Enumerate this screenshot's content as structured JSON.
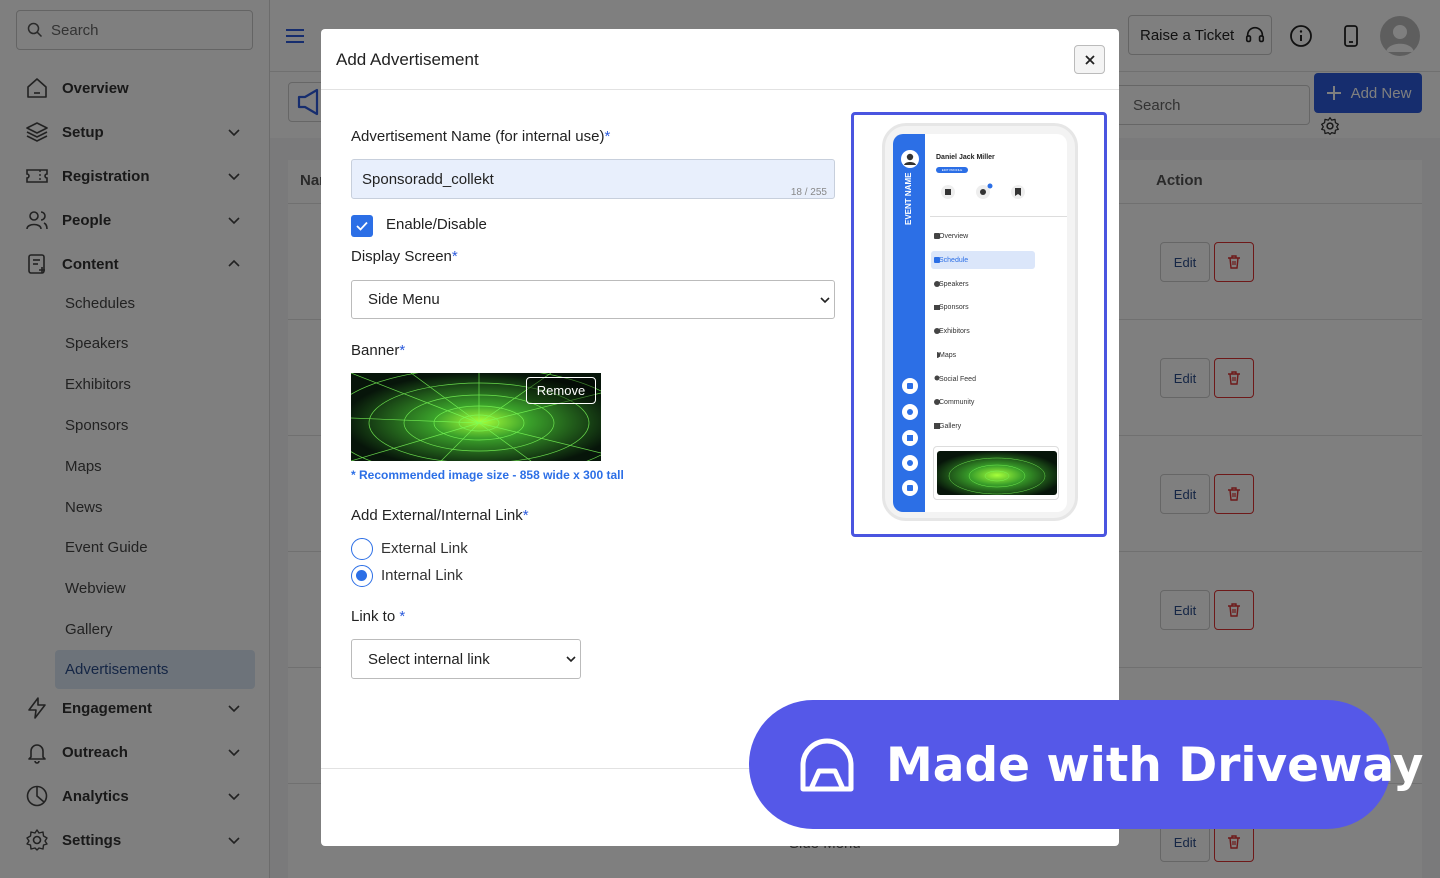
{
  "sidebar": {
    "search_placeholder": "Search",
    "items": [
      {
        "label": "Overview",
        "icon": "home-icon"
      },
      {
        "label": "Setup",
        "icon": "layers-icon"
      },
      {
        "label": "Registration",
        "icon": "ticket-icon"
      },
      {
        "label": "People",
        "icon": "people-icon"
      },
      {
        "label": "Content",
        "icon": "content-icon"
      },
      {
        "label": "Engagement",
        "icon": "bolt-icon"
      },
      {
        "label": "Outreach",
        "icon": "bell-icon"
      },
      {
        "label": "Analytics",
        "icon": "pie-icon"
      },
      {
        "label": "Settings",
        "icon": "gear-icon"
      }
    ],
    "content_sub": [
      "Schedules",
      "Speakers",
      "Exhibitors",
      "Sponsors",
      "Maps",
      "News",
      "Event Guide",
      "Webview",
      "Gallery",
      "Advertisements"
    ],
    "active_sub": "Advertisements"
  },
  "header": {
    "raise_ticket": "Raise a Ticket"
  },
  "page": {
    "search_placeholder": "Search",
    "add_new": "Add New",
    "col_name": "Nar",
    "col_action": "Action",
    "edit_label": "Edit",
    "bottom_fragment": "Side Menu"
  },
  "modal": {
    "title": "Add Advertisement",
    "name_label": "Advertisement Name (for internal use)",
    "name_value": "Sponsoradd_collekt",
    "name_counter": "18 / 255",
    "enable_label": "Enable/Disable",
    "display_screen_label": "Display Screen",
    "display_screen_value": "Side Menu",
    "banner_label": "Banner",
    "remove_label": "Remove",
    "banner_hint": "* Recommended image size - 858 wide x 300 tall",
    "link_label": "Add External/Internal Link",
    "external_link": "External Link",
    "internal_link": "Internal Link",
    "selected_link": "Internal Link",
    "link_to_label": "Link to ",
    "link_to_value": "Select internal link",
    "required_mark": "*"
  },
  "preview": {
    "user_name": "Daniel Jack Miller",
    "edit_profile": "EDIT PROFILE",
    "event_name": "EVENT NAME",
    "quick_links": [
      "My Agenda",
      "Messages",
      "Bookmarks"
    ],
    "menu": [
      "Overview",
      "Schedule",
      "Speakers",
      "Sponsors",
      "Exhibitors",
      "Maps",
      "Social Feed",
      "Community",
      "Gallery"
    ],
    "active_menu": "Schedule"
  },
  "watermark": {
    "text": "Made with Driveway"
  },
  "colors": {
    "accent": "#2c6fe6",
    "badge": "#5558e8",
    "delete": "#d33333"
  }
}
